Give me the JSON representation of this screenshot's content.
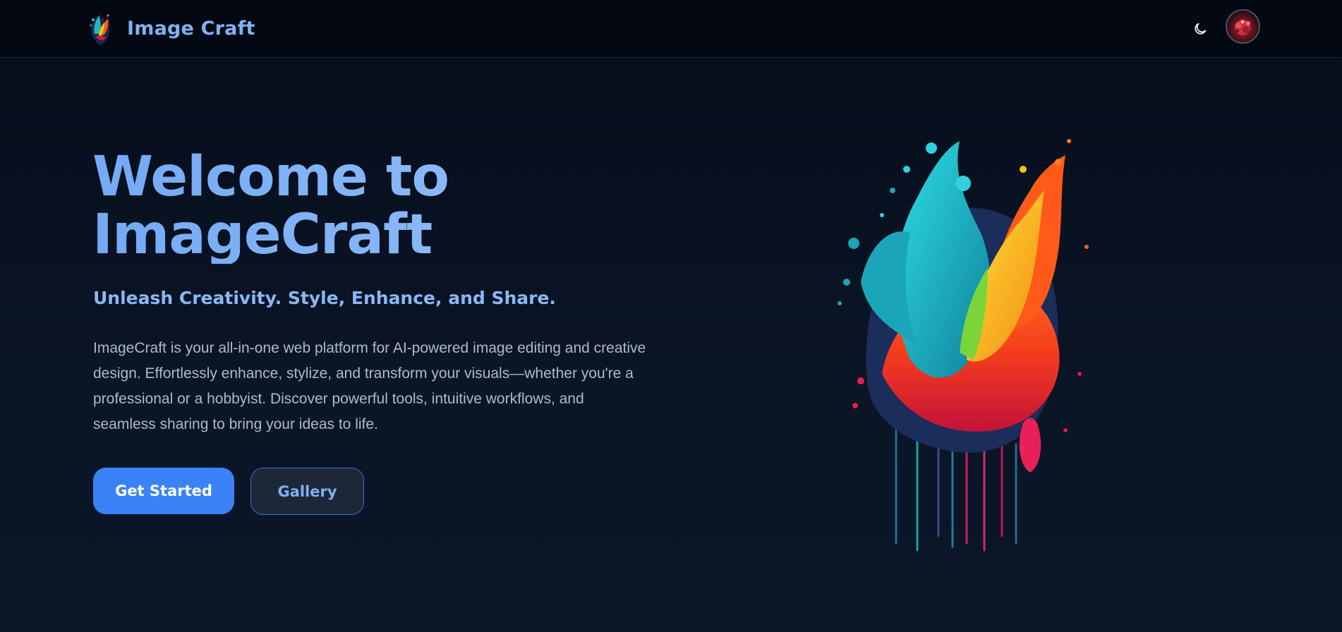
{
  "header": {
    "brand_name": "Image Craft",
    "logo_icon": "paint-splash-logo",
    "theme_icon": "moon-icon",
    "avatar_icon": "user-avatar"
  },
  "hero": {
    "title_line1": "Welcome to",
    "title_line2": "ImageCraft",
    "tagline": "Unleash Creativity. Style, Enhance, and Share.",
    "description": "ImageCraft is your all-in-one web platform for AI-powered image editing and creative design. Effortlessly enhance, stylize, and transform your visuals—whether you're a professional or a hobbyist. Discover powerful tools, intuitive workflows, and seamless sharing to bring your ideas to life.",
    "primary_button": "Get Started",
    "secondary_button": "Gallery",
    "illustration_icon": "paint-splash-illustration"
  },
  "colors": {
    "background": "#0a1424",
    "header_background": "#030812",
    "accent": "#3b82f6",
    "title": "#7fb3f7",
    "body_text": "#aeb9c9"
  }
}
